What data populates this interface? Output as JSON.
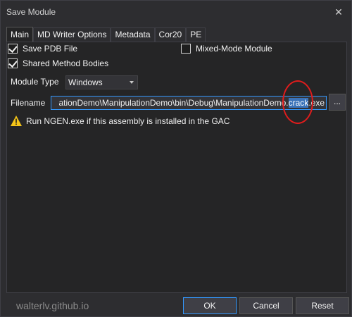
{
  "window": {
    "title": "Save Module",
    "close_glyph": "✕"
  },
  "tabs": [
    {
      "label": "Main",
      "active": true
    },
    {
      "label": "MD Writer Options",
      "active": false
    },
    {
      "label": "Metadata",
      "active": false
    },
    {
      "label": "Cor20",
      "active": false
    },
    {
      "label": "PE",
      "active": false
    }
  ],
  "main": {
    "save_pdb": {
      "label": "Save PDB File",
      "checked": true
    },
    "mixed_mode": {
      "label": "Mixed-Mode Module",
      "checked": false
    },
    "shared_bodies": {
      "label": "Shared Method Bodies",
      "checked": true
    },
    "module_type": {
      "label": "Module Type",
      "value": "Windows"
    },
    "filename": {
      "label": "Filename",
      "prefix": "ationDemo\\ManipulationDemo\\bin\\Debug\\ManipulationDemo.",
      "selected": "crack",
      "suffix": ".exe"
    },
    "browse_label": "...",
    "warning_text": "Run NGEN.exe if this assembly is installed in the GAC"
  },
  "watermark": "walterlv.github.io",
  "buttons": {
    "ok": "OK",
    "cancel": "Cancel",
    "reset": "Reset"
  },
  "colors": {
    "accent": "#3399ff",
    "selection": "#3b73b9",
    "annotation": "#e01c1c",
    "warning": "#f5c518"
  }
}
